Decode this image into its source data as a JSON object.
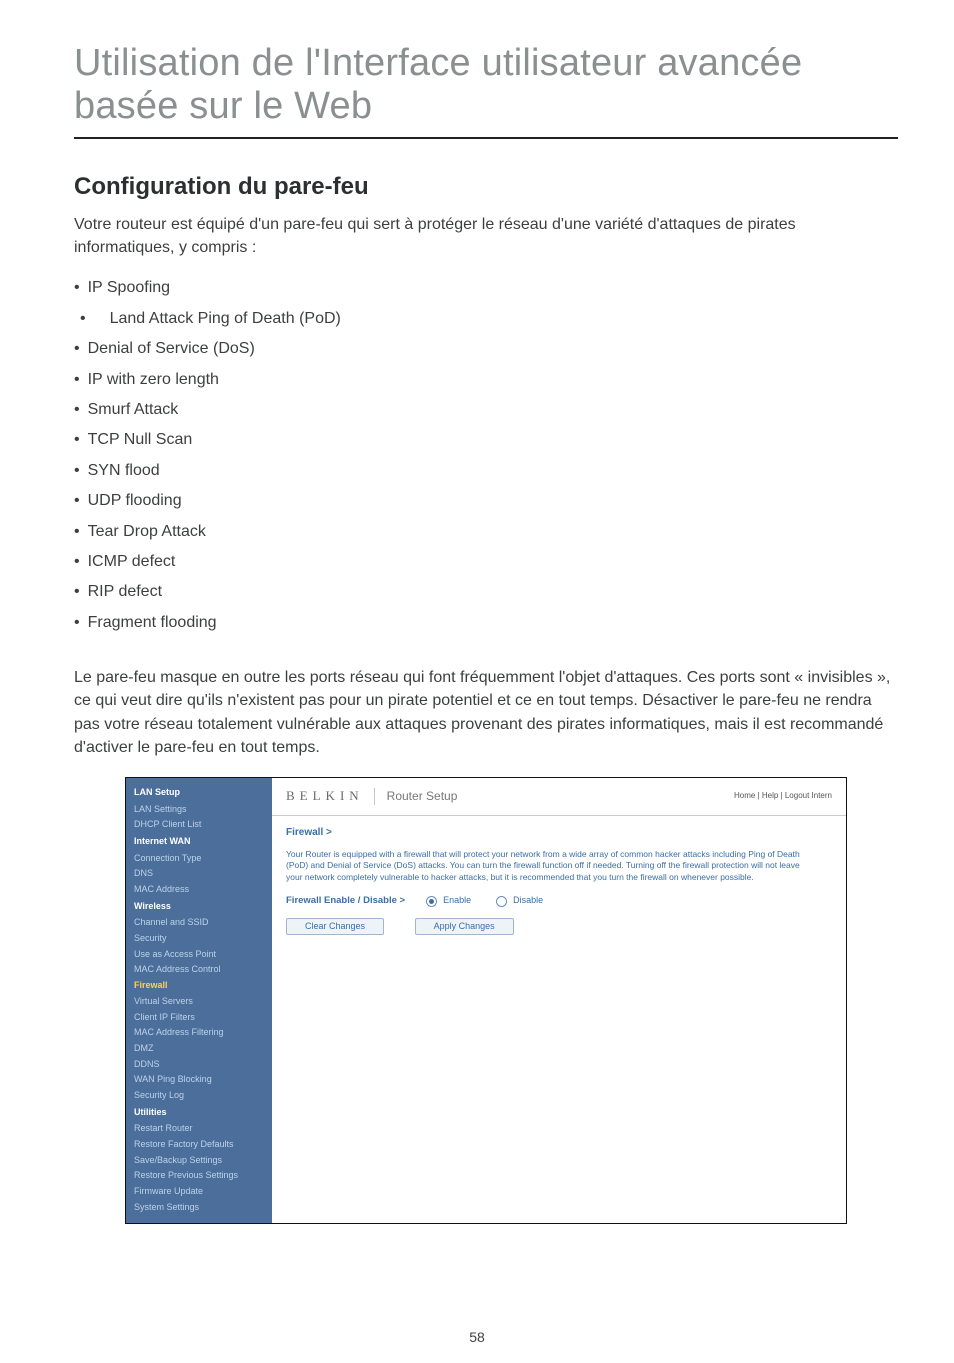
{
  "doc": {
    "title_line1": "Utilisation de l'Interface utilisateur avancée",
    "title_line2": "basée sur le Web",
    "section_heading": "Configuration du pare-feu",
    "intro": "Votre routeur est équipé d'un pare-feu qui sert à protéger le réseau d'une variété d'attaques de pirates informatiques, y compris :",
    "bullets": [
      "IP Spoofing",
      "Land Attack Ping of Death (PoD)",
      "Denial of Service (DoS)",
      "IP with zero length",
      "Smurf Attack",
      "TCP Null Scan",
      "SYN flood",
      "UDP flooding",
      "Tear Drop Attack",
      "ICMP defect",
      "RIP defect",
      "Fragment flooding"
    ],
    "paragraph": "Le pare-feu masque en outre les ports réseau qui font fréquemment l'objet d'attaques. Ces ports sont « invisibles », ce qui veut dire qu'ils n'existent pas pour un pirate potentiel et ce en tout temps. Désactiver le pare-feu ne rendra pas votre réseau totalement vulnérable aux attaques provenant des pirates informatiques, mais il est recommandé d'activer le pare-feu en tout temps.",
    "page_number": "58"
  },
  "router": {
    "brand": "BELKIN",
    "setup_title": "Router Setup",
    "top_links": "Home | Help | Logout   Intern",
    "sidebar": {
      "groups": [
        {
          "name": "LAN Setup",
          "items": [
            "LAN Settings",
            "DHCP Client List"
          ]
        },
        {
          "name": "Internet WAN",
          "items": [
            "Connection Type",
            "DNS",
            "MAC Address"
          ]
        },
        {
          "name": "Wireless",
          "items": [
            "Channel and SSID",
            "Security",
            "Use as Access Point",
            "MAC Address Control"
          ]
        },
        {
          "name": "Firewall",
          "active": true,
          "items": [
            "Virtual Servers",
            "Client IP Filters",
            "MAC Address Filtering",
            "DMZ",
            "DDNS",
            "WAN Ping Blocking",
            "Security Log"
          ]
        },
        {
          "name": "Utilities",
          "items": [
            "Restart Router",
            "Restore Factory Defaults",
            "Save/Backup Settings",
            "Restore Previous Settings",
            "Firmware Update",
            "System Settings"
          ]
        }
      ]
    },
    "panel": {
      "breadcrumb": "Firewall >",
      "description": "Your Router is equipped with a firewall that will protect your network from a wide array of common hacker attacks including Ping of Death (PoD) and Denial of Service (DoS) attacks. You can turn the firewall function off if needed. Turning off the firewall protection will not leave your network completely vulnerable to hacker attacks, but it is recommended that you turn the firewall on whenever possible.",
      "toggle_label": "Firewall Enable / Disable >",
      "enable_label": "Enable",
      "disable_label": "Disable",
      "clear_button": "Clear Changes",
      "apply_button": "Apply Changes"
    }
  }
}
